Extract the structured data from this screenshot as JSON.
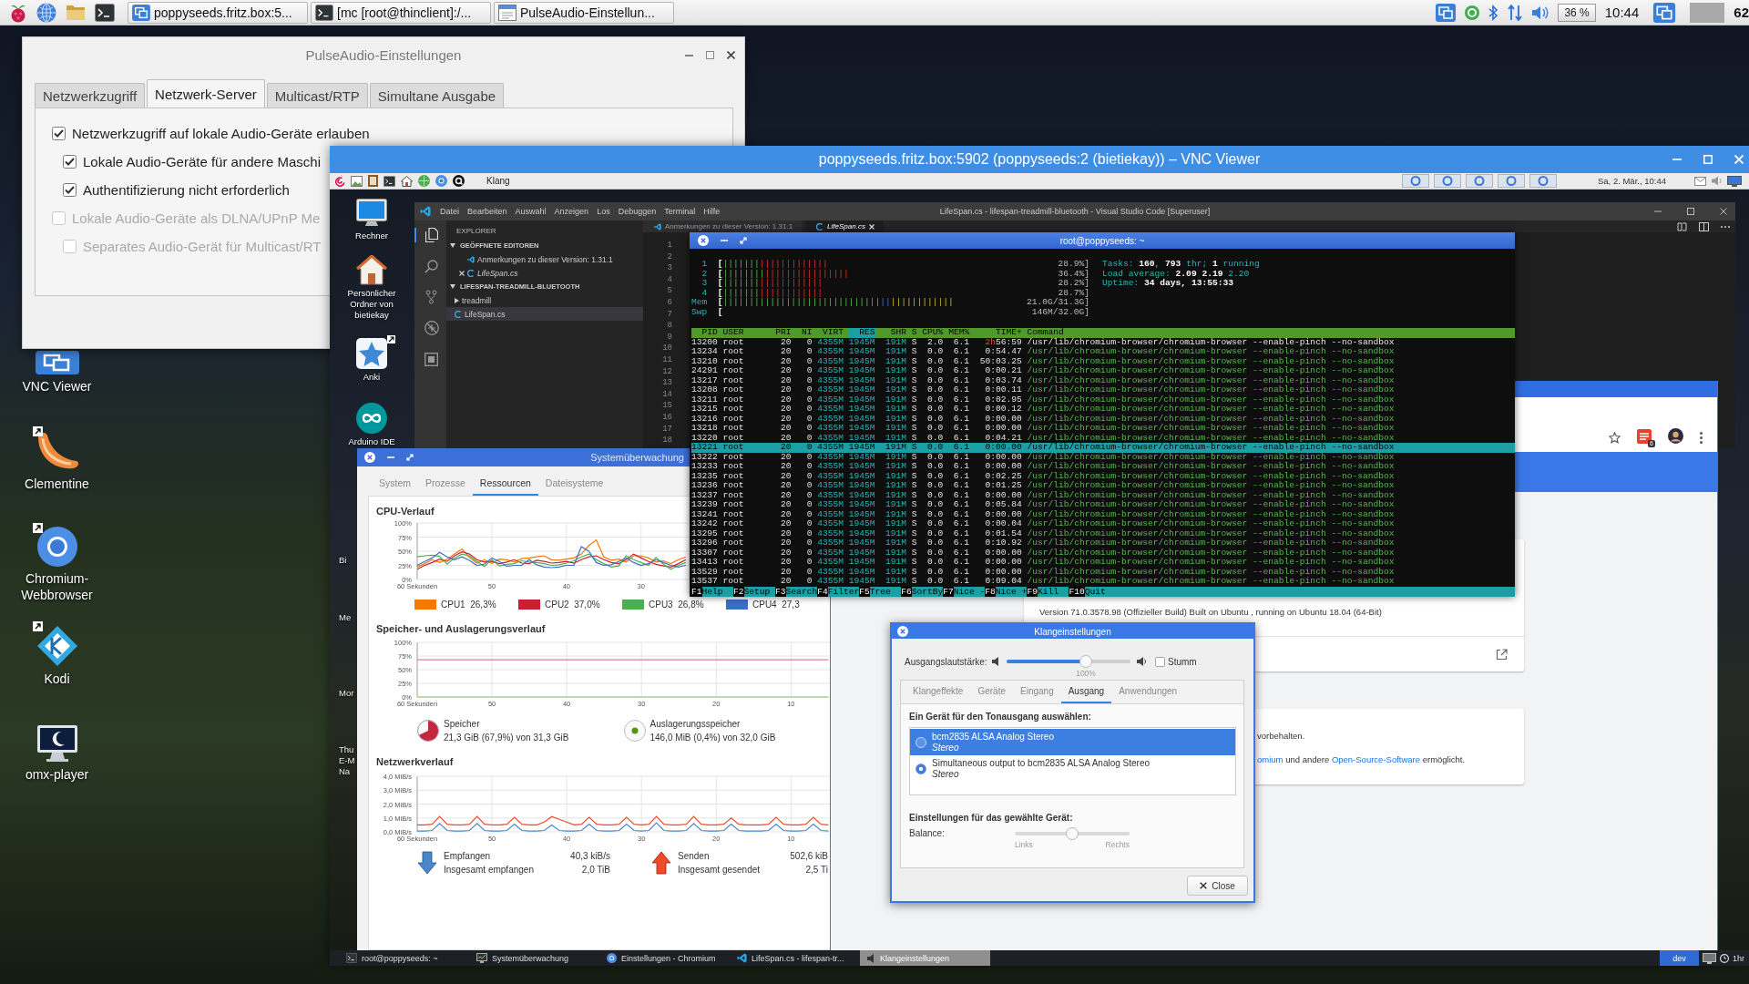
{
  "host_panel": {
    "tasks": [
      {
        "label": "poppyseeds.fritz.box:5...",
        "kind": "vnc",
        "selected": false
      },
      {
        "label": "[mc [root@thinclient]:/...",
        "kind": "terminal",
        "selected": false
      },
      {
        "label": "PulseAudio-Einstellun...",
        "kind": "settings",
        "selected": false
      }
    ],
    "cpu_usage": "36 %",
    "clock": "10:44",
    "counter": "62"
  },
  "desktop_icons": [
    {
      "label": "VNC Viewer",
      "kind": "vnc",
      "shortcut": false
    },
    {
      "label": "Clementine",
      "kind": "clementine",
      "shortcut": true
    },
    {
      "label": "Chromium-Webbrowser",
      "kind": "chromium",
      "shortcut": true
    },
    {
      "label": "Kodi",
      "kind": "kodi",
      "shortcut": true
    },
    {
      "label": "omx-player",
      "kind": "monitor",
      "shortcut": false
    }
  ],
  "pulseaudio_window": {
    "title": "PulseAudio-Einstellungen",
    "tabs": [
      {
        "label": "Netzwerkzugriff",
        "selected": false
      },
      {
        "label": "Netzwerk-Server",
        "selected": true
      },
      {
        "label": "Multicast/RTP",
        "selected": false
      },
      {
        "label": "Simultane Ausgabe",
        "selected": false
      }
    ],
    "options": [
      {
        "label": "Netzwerkzugriff auf lokale Audio-Geräte erlauben",
        "checked": true,
        "disabled": false,
        "children": [
          {
            "label": "Lokale Audio-Geräte für andere Maschi",
            "checked": true,
            "disabled": false
          },
          {
            "label": "Authentifizierung nicht erforderlich",
            "checked": true,
            "disabled": false
          }
        ]
      },
      {
        "label": "Lokale Audio-Geräte als DLNA/UPnP Me",
        "checked": false,
        "disabled": true,
        "children": [
          {
            "label": "Separates Audio-Gerät für Multicast/RT",
            "checked": false,
            "disabled": true
          }
        ]
      }
    ]
  },
  "vnc_window": {
    "title": "poppyseeds.fritz.box:5902 (poppyseeds:2 (bietiekay)) – VNC Viewer",
    "remote_panel": {
      "launcher_label": "Klang",
      "clock": "Sa, 2. Mär., 10:44"
    },
    "remote_desktop_icons": [
      {
        "label": "Rechner",
        "kind": "monitor",
        "shortcut": false
      },
      {
        "label": "Persönlicher Ordner von bietiekay",
        "kind": "home",
        "shortcut": false
      },
      {
        "label": "Anki",
        "kind": "star-card",
        "shortcut": true
      },
      {
        "label": "Arduino IDE",
        "kind": "infinity",
        "shortcut": false
      }
    ],
    "partial_icon_labels": [
      "Bi",
      "Me",
      "Mor",
      "Thu",
      "E-M",
      "Na"
    ],
    "code_editor": {
      "title": "LifeSpan.cs - lifespan-treadmill-bluetooth - Visual Studio Code [Superuser]",
      "menu": [
        "Datei",
        "Bearbeiten",
        "Auswahl",
        "Anzeigen",
        "Los",
        "Debuggen",
        "Terminal",
        "Hilfe"
      ],
      "activity_bar": [
        {
          "kind": "files",
          "selected": true
        },
        {
          "kind": "search",
          "selected": false
        },
        {
          "kind": "source-control",
          "selected": false
        },
        {
          "kind": "debug",
          "selected": false
        },
        {
          "kind": "extensions",
          "selected": false
        }
      ],
      "explorer": {
        "heading": "EXPLORER",
        "sections": [
          {
            "title": "GEÖFFNETE EDITOREN",
            "expanded": true,
            "items": [
              {
                "label": "Anmerkungen zu dieser Version: 1.31.1",
                "kind": "release-notes",
                "selected": false,
                "preview": false
              },
              {
                "label": "LifeSpan.cs",
                "kind": "csharp",
                "selected": true,
                "preview": true
              }
            ]
          },
          {
            "title": "LIFESPAN-TREADMILL-BLUETOOTH",
            "expanded": true,
            "items": [
              {
                "label": "treadmill",
                "kind": "folder",
                "expanded": false,
                "selected": false,
                "preview": false
              },
              {
                "label": "LifeSpan.cs",
                "kind": "csharp",
                "selected": true,
                "preview": false
              }
            ]
          }
        ]
      },
      "tabs": [
        {
          "label": "Anmerkungen zu dieser Version: 1.31.1",
          "kind": "release-notes",
          "selected": false,
          "preview": false
        },
        {
          "label": "LifeSpan.cs",
          "kind": "csharp",
          "selected": true,
          "preview": true
        }
      ],
      "line_numbers": [
        "1",
        "2",
        "3",
        "4",
        "5",
        "6",
        "7",
        "8",
        "9",
        "10",
        "11",
        "12",
        "13",
        "14",
        "15",
        "16",
        "17",
        "18"
      ]
    },
    "terminal": {
      "title": "root@poppyseeds: ~",
      "meters": [
        {
          "label": "1",
          "bracket": "[",
          "bars": [
            {
              "text": "|||||||",
              "kind": "normal"
            },
            {
              "text": "|||||||||||||",
              "kind": "kernel"
            }
          ],
          "reading": "28.9%]"
        },
        {
          "label": "2",
          "bracket": "[",
          "bars": [
            {
              "text": "||||||||",
              "kind": "normal"
            },
            {
              "text": "||||||||||||||||",
              "kind": "kernel"
            }
          ],
          "reading": "36.4%]"
        },
        {
          "label": "3",
          "bracket": "[",
          "bars": [
            {
              "text": "|||||||",
              "kind": "normal"
            },
            {
              "text": "||||||||||||",
              "kind": "kernel"
            }
          ],
          "reading": "28.2%]"
        },
        {
          "label": "4",
          "bracket": "[",
          "bars": [
            {
              "text": "|||||||",
              "kind": "normal"
            },
            {
              "text": "||||||||||||",
              "kind": "kernel"
            }
          ],
          "reading": "28.7%]"
        },
        {
          "label": "Mem",
          "bracket": "[",
          "bars": [
            {
              "text": "||||||||||||||||||||||||||||||",
              "kind": "used"
            },
            {
              "text": "||",
              "kind": "buffers"
            },
            {
              "text": "||||||||||||",
              "kind": "cache"
            }
          ],
          "reading": "21.0G/31.3G]"
        },
        {
          "label": "Swp",
          "bracket": "[",
          "reading": "146M/32.0G]"
        }
      ],
      "summary": [
        "Tasks: **160**, **793** thr; **1** running",
        "Load average: **2.09** **2.19** 2.20",
        "Uptime: **34 days, 13:55:33**"
      ],
      "columns": [
        {
          "label": "PID",
          "selected": false
        },
        {
          "label": "USER",
          "selected": false
        },
        {
          "label": "PRI",
          "selected": false
        },
        {
          "label": "NI",
          "selected": false
        },
        {
          "label": "VIRT",
          "selected": false
        },
        {
          "label": "RES",
          "selected": true
        },
        {
          "label": "SHR",
          "selected": false
        },
        {
          "label": "S",
          "selected": false
        },
        {
          "label": "CPU%",
          "selected": false
        },
        {
          "label": "MEM%",
          "selected": false
        },
        {
          "label": "TIME+",
          "selected": false
        },
        {
          "label": "Command",
          "selected": false
        }
      ],
      "rows": [
        {
          "cells": [
            "13200",
            "root",
            "20",
            "0",
            "4355M",
            "1945M",
            "191M",
            "S",
            "2.0",
            "6.1",
            "**2h**56:59",
            "/usr/lib/chromium-browser/chromium-browser --enable-pinch --no-sandbox"
          ],
          "selected": false,
          "thread": false
        },
        {
          "cells": [
            "13234",
            "root",
            "20",
            "0",
            "4355M",
            "1945M",
            "191M",
            "S",
            "0.0",
            "6.1",
            "0:54.47",
            "/usr/lib/chromium-browser/chromium-browser --enable-pinch --no-sandbox"
          ],
          "selected": false,
          "thread": true
        },
        {
          "cells": [
            "13210",
            "root",
            "20",
            "0",
            "4355M",
            "1945M",
            "191M",
            "S",
            "0.0",
            "6.1",
            "50:03.25",
            "/usr/lib/chromium-browser/chromium-browser --enable-pinch --no-sandbox"
          ],
          "selected": false,
          "thread": true
        },
        {
          "cells": [
            "24291",
            "root",
            "20",
            "0",
            "4355M",
            "1945M",
            "191M",
            "S",
            "0.0",
            "6.1",
            "0:00.21",
            "/usr/lib/chromium-browser/chromium-browser --enable-pinch --no-sandbox"
          ],
          "selected": false,
          "thread": true
        },
        {
          "cells": [
            "13217",
            "root",
            "20",
            "0",
            "4355M",
            "1945M",
            "191M",
            "S",
            "0.0",
            "6.1",
            "0:03.74",
            "/usr/lib/chromium-browser/chromium-browser --enable-pinch --no-sandbox"
          ],
          "selected": false,
          "thread": true
        },
        {
          "cells": [
            "13208",
            "root",
            "20",
            "0",
            "4355M",
            "1945M",
            "191M",
            "S",
            "0.0",
            "6.1",
            "0:00.11",
            "/usr/lib/chromium-browser/chromium-browser --enable-pinch --no-sandbox"
          ],
          "selected": false,
          "thread": true
        },
        {
          "cells": [
            "13211",
            "root",
            "20",
            "0",
            "4355M",
            "1945M",
            "191M",
            "S",
            "0.0",
            "6.1",
            "0:02.95",
            "/usr/lib/chromium-browser/chromium-browser --enable-pinch --no-sandbox"
          ],
          "selected": false,
          "thread": true
        },
        {
          "cells": [
            "13215",
            "root",
            "20",
            "0",
            "4355M",
            "1945M",
            "191M",
            "S",
            "0.0",
            "6.1",
            "0:00.12",
            "/usr/lib/chromium-browser/chromium-browser --enable-pinch --no-sandbox"
          ],
          "selected": false,
          "thread": true
        },
        {
          "cells": [
            "13216",
            "root",
            "20",
            "0",
            "4355M",
            "1945M",
            "191M",
            "S",
            "0.0",
            "6.1",
            "0:00.00",
            "/usr/lib/chromium-browser/chromium-browser --enable-pinch --no-sandbox"
          ],
          "selected": false,
          "thread": true
        },
        {
          "cells": [
            "13218",
            "root",
            "20",
            "0",
            "4355M",
            "1945M",
            "191M",
            "S",
            "0.0",
            "6.1",
            "0:00.00",
            "/usr/lib/chromium-browser/chromium-browser --enable-pinch --no-sandbox"
          ],
          "selected": false,
          "thread": true
        },
        {
          "cells": [
            "13220",
            "root",
            "20",
            "0",
            "4355M",
            "1945M",
            "191M",
            "S",
            "0.0",
            "6.1",
            "0:04.21",
            "/usr/lib/chromium-browser/chromium-browser --enable-pinch --no-sandbox"
          ],
          "selected": false,
          "thread": true
        },
        {
          "cells": [
            "13221",
            "root",
            "20",
            "0",
            "4355M",
            "1945M",
            "191M",
            "S",
            "0.0",
            "6.1",
            "0:00.00",
            "/usr/lib/chromium-browser/chromium-browser --enable-pinch --no-sandbox"
          ],
          "selected": true,
          "thread": true
        },
        {
          "cells": [
            "13222",
            "root",
            "20",
            "0",
            "4355M",
            "1945M",
            "191M",
            "S",
            "0.0",
            "6.1",
            "0:00.00",
            "/usr/lib/chromium-browser/chromium-browser --enable-pinch --no-sandbox"
          ],
          "selected": false,
          "thread": true
        },
        {
          "cells": [
            "13233",
            "root",
            "20",
            "0",
            "4355M",
            "1945M",
            "191M",
            "S",
            "0.0",
            "6.1",
            "0:00.00",
            "/usr/lib/chromium-browser/chromium-browser --enable-pinch --no-sandbox"
          ],
          "selected": false,
          "thread": true
        },
        {
          "cells": [
            "13235",
            "root",
            "20",
            "0",
            "4355M",
            "1945M",
            "191M",
            "S",
            "0.0",
            "6.1",
            "0:02.25",
            "/usr/lib/chromium-browser/chromium-browser --enable-pinch --no-sandbox"
          ],
          "selected": false,
          "thread": true
        },
        {
          "cells": [
            "13236",
            "root",
            "20",
            "0",
            "4355M",
            "1945M",
            "191M",
            "S",
            "0.0",
            "6.1",
            "0:01.25",
            "/usr/lib/chromium-browser/chromium-browser --enable-pinch --no-sandbox"
          ],
          "selected": false,
          "thread": true
        },
        {
          "cells": [
            "13237",
            "root",
            "20",
            "0",
            "4355M",
            "1945M",
            "191M",
            "S",
            "0.0",
            "6.1",
            "0:00.00",
            "/usr/lib/chromium-browser/chromium-browser --enable-pinch --no-sandbox"
          ],
          "selected": false,
          "thread": true
        },
        {
          "cells": [
            "13239",
            "root",
            "20",
            "0",
            "4355M",
            "1945M",
            "191M",
            "S",
            "0.0",
            "6.1",
            "0:05.84",
            "/usr/lib/chromium-browser/chromium-browser --enable-pinch --no-sandbox"
          ],
          "selected": false,
          "thread": true
        },
        {
          "cells": [
            "13241",
            "root",
            "20",
            "0",
            "4355M",
            "1945M",
            "191M",
            "S",
            "0.0",
            "6.1",
            "0:00.00",
            "/usr/lib/chromium-browser/chromium-browser --enable-pinch --no-sandbox"
          ],
          "selected": false,
          "thread": true
        },
        {
          "cells": [
            "13242",
            "root",
            "20",
            "0",
            "4355M",
            "1945M",
            "191M",
            "S",
            "0.0",
            "6.1",
            "0:00.04",
            "/usr/lib/chromium-browser/chromium-browser --enable-pinch --no-sandbox"
          ],
          "selected": false,
          "thread": true
        },
        {
          "cells": [
            "13295",
            "root",
            "20",
            "0",
            "4355M",
            "1945M",
            "191M",
            "S",
            "0.0",
            "6.1",
            "0:01.54",
            "/usr/lib/chromium-browser/chromium-browser --enable-pinch --no-sandbox"
          ],
          "selected": false,
          "thread": true
        },
        {
          "cells": [
            "13296",
            "root",
            "20",
            "0",
            "4355M",
            "1945M",
            "191M",
            "S",
            "0.0",
            "6.1",
            "0:10.92",
            "/usr/lib/chromium-browser/chromium-browser --enable-pinch --no-sandbox"
          ],
          "selected": false,
          "thread": true
        },
        {
          "cells": [
            "13307",
            "root",
            "20",
            "0",
            "4355M",
            "1945M",
            "191M",
            "S",
            "0.0",
            "6.1",
            "0:00.00",
            "/usr/lib/chromium-browser/chromium-browser --enable-pinch --no-sandbox"
          ],
          "selected": false,
          "thread": true
        },
        {
          "cells": [
            "13413",
            "root",
            "20",
            "0",
            "4355M",
            "1945M",
            "191M",
            "S",
            "0.0",
            "6.1",
            "0:00.00",
            "/usr/lib/chromium-browser/chromium-browser --enable-pinch --no-sandbox"
          ],
          "selected": false,
          "thread": true
        },
        {
          "cells": [
            "13529",
            "root",
            "20",
            "0",
            "4355M",
            "1945M",
            "191M",
            "S",
            "0.0",
            "6.1",
            "0:00.00",
            "/usr/lib/chromium-browser/chromium-browser --enable-pinch --no-sandbox"
          ],
          "selected": false,
          "thread": true
        },
        {
          "cells": [
            "13537",
            "root",
            "20",
            "0",
            "4355M",
            "1945M",
            "191M",
            "S",
            "0.0",
            "6.1",
            "0:09.04",
            "/usr/lib/chromium-browser/chromium-browser --enable-pinch --no-sandbox"
          ],
          "selected": false,
          "thread": true
        }
      ],
      "function_keys": [
        {
          "key": "F1",
          "label": "Help"
        },
        {
          "key": "F2",
          "label": "Setup"
        },
        {
          "key": "F3",
          "label": "Search"
        },
        {
          "key": "F4",
          "label": "Filter"
        },
        {
          "key": "F5",
          "label": "Tree"
        },
        {
          "key": "F6",
          "label": "SortBy"
        },
        {
          "key": "F7",
          "label": "Nice -"
        },
        {
          "key": "F8",
          "label": "Nice +"
        },
        {
          "key": "F9",
          "label": "Kill"
        },
        {
          "key": "F10",
          "label": "Quit"
        }
      ]
    },
    "system_monitor": {
      "title": "Systemüberwachung",
      "tabs": [
        {
          "label": "System",
          "selected": false
        },
        {
          "label": "Prozesse",
          "selected": false
        },
        {
          "label": "Ressourcen",
          "selected": true
        },
        {
          "label": "Dateisysteme",
          "selected": false
        }
      ],
      "cpu": {
        "heading": "CPU-Verlauf",
        "chart_data": {
          "type": "line",
          "x": [
            60,
            59,
            58,
            57,
            56,
            55,
            54,
            53,
            52,
            51,
            50,
            49,
            48,
            47,
            46,
            45,
            44,
            43,
            42,
            41,
            40,
            39,
            38,
            37,
            36,
            35,
            34,
            33,
            32,
            31,
            30,
            29,
            28,
            27,
            26,
            25,
            24
          ],
          "series": [
            {
              "name": "CPU1",
              "color": "#f57900",
              "values": [
                22,
                28,
                35,
                30,
                36,
                45,
                54,
                39,
                29,
                35,
                28,
                36,
                35,
                31,
                37,
                38,
                40,
                42,
                35,
                34,
                36,
                38,
                45,
                60,
                70,
                40,
                34,
                36,
                31,
                42,
                42,
                38,
                31,
                33,
                28,
                35,
                40
              ]
            },
            {
              "name": "CPU2",
              "color": "#cc1f2f",
              "values": [
                18,
                25,
                30,
                36,
                32,
                42,
                49,
                45,
                35,
                31,
                32,
                28,
                31,
                35,
                29,
                28,
                34,
                32,
                29,
                30,
                32,
                29,
                35,
                40,
                42,
                35,
                30,
                28,
                35,
                45,
                38,
                32,
                27,
                24,
                22,
                28,
                35
              ]
            },
            {
              "name": "CPU3",
              "color": "#4caf50",
              "values": [
                40,
                42,
                43,
                41,
                27,
                38,
                45,
                42,
                32,
                23,
                35,
                24,
                27,
                28,
                33,
                31,
                30,
                28,
                25,
                26,
                29,
                33,
                40,
                45,
                35,
                28,
                22,
                24,
                42,
                35,
                30,
                25,
                39,
                27,
                18,
                25,
                30
              ]
            },
            {
              "name": "CPU4",
              "color": "#3a6fc4",
              "values": [
                25,
                32,
                38,
                48,
                40,
                35,
                40,
                34,
                25,
                27,
                38,
                32,
                23,
                25,
                25,
                35,
                26,
                22,
                21,
                22,
                25,
                25,
                58,
                50,
                30,
                25,
                26,
                32,
                38,
                30,
                25,
                28,
                35,
                30,
                25,
                22,
                25
              ]
            }
          ],
          "xlim": [
            60,
            23.5
          ],
          "ylim": [
            0,
            100
          ],
          "grid": true,
          "xticks": [
            {
              "value": 60,
              "label": "60 Sekunden"
            },
            {
              "value": 50,
              "label": "50"
            },
            {
              "value": 40,
              "label": "40"
            },
            {
              "value": 30,
              "label": "30"
            }
          ],
          "yticks": [
            {
              "value": 100,
              "label": "100%"
            },
            {
              "value": 75,
              "label": "75%"
            },
            {
              "value": 50,
              "label": "50%"
            },
            {
              "value": 25,
              "label": "25%"
            },
            {
              "value": 0,
              "label": "0%"
            }
          ]
        },
        "legend_values": [
          "26,3%",
          "37,0%",
          "26,8%",
          "27,3"
        ]
      },
      "memory": {
        "heading": "Speicher- und Auslagerungsverlauf",
        "chart_data": {
          "type": "line",
          "x": [
            60,
            5
          ],
          "series": [
            {
              "name": "Speicher",
              "color": "#e27d92",
              "values": [
                68,
                68
              ]
            },
            {
              "name": "Auslagerungsspeicher",
              "color": "#8cc46c",
              "values": [
                0,
                0
              ]
            }
          ],
          "xlim": [
            60,
            4.8
          ],
          "ylim": [
            0,
            100
          ],
          "grid": true,
          "xticks": [
            {
              "value": 60,
              "label": "60 Sekunden"
            },
            {
              "value": 50,
              "label": "50"
            },
            {
              "value": 40,
              "label": "40"
            },
            {
              "value": 30,
              "label": "30"
            },
            {
              "value": 20,
              "label": "20"
            },
            {
              "value": 10,
              "label": "10"
            }
          ],
          "yticks": [
            {
              "value": 100,
              "label": "100%"
            },
            {
              "value": 75,
              "label": "75%"
            },
            {
              "value": 50,
              "label": "50%"
            },
            {
              "value": 25,
              "label": "25%"
            },
            {
              "value": 0,
              "label": "0%"
            }
          ]
        },
        "ram_value": "21,3 GiB (67,9%) von 31,3 GiB",
        "swap_value": "146,0 MiB (0,4%) von 32,0 GiB"
      },
      "network": {
        "heading": "Netzwerkverlauf",
        "chart_data": {
          "type": "line",
          "x": [
            60,
            59,
            58,
            57,
            56,
            55,
            54,
            53,
            52,
            51,
            50,
            49,
            48,
            47,
            46,
            45,
            44,
            43,
            42,
            41,
            40,
            39,
            38,
            37,
            36,
            35,
            34,
            33,
            32,
            31,
            30,
            29,
            28,
            27,
            26,
            25,
            24,
            23,
            22,
            21,
            20,
            19,
            18,
            17,
            16,
            15,
            14,
            13,
            12,
            11,
            10,
            9,
            8,
            7,
            6,
            5
          ],
          "series": [
            {
              "name": "Empfangen",
              "color": "#4a86c8",
              "values": [
                0.05,
                0.05,
                0.1,
                0.6,
                0.1,
                0.05,
                0.05,
                0.1,
                0.6,
                0.1,
                0.05,
                0.05,
                0.1,
                0.55,
                0.1,
                0.05,
                0.05,
                0.1,
                0.5,
                0.1,
                0.05,
                0.05,
                0.1,
                0.55,
                0.1,
                0.05,
                0.05,
                0.1,
                0.55,
                0.1,
                0.05,
                0.1,
                0.65,
                0.1,
                0.05,
                0.05,
                0.1,
                0.6,
                0.1,
                0.05,
                0.05,
                0.1,
                0.55,
                0.1,
                0.05,
                0.05,
                0.05,
                0.1,
                0.55,
                0.1,
                0.05,
                0.05,
                0.1,
                0.55,
                0.1,
                0.05
              ]
            },
            {
              "name": "Senden",
              "color": "#ef4a2a",
              "values": [
                0.5,
                0.5,
                0.55,
                1.1,
                0.55,
                0.5,
                0.5,
                0.55,
                1.1,
                0.55,
                0.5,
                0.5,
                0.55,
                1.05,
                0.55,
                0.5,
                0.5,
                0.7,
                1.1,
                0.9,
                0.7,
                0.5,
                0.55,
                1.05,
                0.55,
                0.5,
                0.5,
                0.55,
                1.05,
                0.55,
                0.5,
                0.55,
                1.1,
                0.55,
                0.5,
                0.5,
                0.55,
                1.1,
                0.55,
                0.5,
                0.5,
                0.55,
                1.0,
                0.55,
                0.5,
                0.5,
                0.5,
                0.55,
                1.05,
                0.55,
                0.5,
                0.5,
                0.55,
                1.05,
                0.55,
                0.5
              ]
            }
          ],
          "xlim": [
            60,
            4.8
          ],
          "ylim": [
            0,
            4
          ],
          "grid": true,
          "xticks": [
            {
              "value": 60,
              "label": "60 Sekunden"
            },
            {
              "value": 50,
              "label": "50"
            },
            {
              "value": 40,
              "label": "40"
            },
            {
              "value": 30,
              "label": "30"
            },
            {
              "value": 20,
              "label": "20"
            },
            {
              "value": 10,
              "label": "10"
            }
          ],
          "yticks": [
            {
              "value": 4,
              "label": "4,0 MiB/s"
            },
            {
              "value": 3,
              "label": "3,0 MiB/s"
            },
            {
              "value": 2,
              "label": "2,0 MiB/s"
            },
            {
              "value": 1,
              "label": "1,0 MiB/s"
            },
            {
              "value": 0,
              "label": "0,0 MiB/s"
            }
          ]
        },
        "receive": {
          "rate": "40,3 kiB/s",
          "total_label": "Insgesamt empfangen",
          "total": "2,0 TiB"
        },
        "send": {
          "rate": "502,6 kiB",
          "total_label": "Insgesamt gesendet",
          "total": "2,5 Ti"
        }
      }
    },
    "browser": {
      "extension_badge": "6",
      "version": "Version 71.0.3578.98 (Offizieller Build) Built on Ubuntu , running on Ubuntu 18.04 (64-Bit)",
      "rights": "vorbehalten.",
      "credits": [
        {
          "text": "omium",
          "link": true
        },
        {
          "text": " und andere ",
          "link": false
        },
        {
          "text": "Open-Source-Software",
          "link": true
        },
        {
          "text": " ermöglicht.",
          "link": false
        }
      ]
    },
    "sound_dialog": {
      "title": "Klangeinstellungen",
      "volume": {
        "label": "Ausgangslautstärke:",
        "level": 0.64,
        "reading": "100%"
      },
      "mute": {
        "label": "Stumm",
        "checked": false
      },
      "tabs": [
        {
          "label": "Klangeffekte",
          "selected": false
        },
        {
          "label": "Geräte",
          "selected": false
        },
        {
          "label": "Eingang",
          "selected": false
        },
        {
          "label": "Ausgang",
          "selected": true
        },
        {
          "label": "Anwendungen",
          "selected": false
        }
      ],
      "device_heading": "Ein Gerät für den Tonausgang auswählen:",
      "devices": [
        {
          "name": "bcm2835 ALSA Analog Stereo",
          "profile": "Stereo",
          "selected": true,
          "checked": false
        },
        {
          "name": "Simultaneous output to bcm2835 ALSA Analog Stereo",
          "profile": "Stereo",
          "selected": false,
          "checked": true
        }
      ],
      "settings_heading": "Einstellungen für das gewählte Gerät:",
      "balance": {
        "label": "Balance:",
        "level": 0.5,
        "left": "Links",
        "right": "Rechts"
      },
      "close_button": "Close"
    },
    "remote_taskbar": {
      "tasks": [
        {
          "label": "root@poppyseeds: ~",
          "kind": "terminal",
          "selected": false
        },
        {
          "label": "Systemüberwachung",
          "kind": "monitor",
          "selected": false
        },
        {
          "label": "Einstellungen - Chromium",
          "kind": "browser",
          "selected": false
        },
        {
          "label": "LifeSpan.cs - lifespan-tr...",
          "kind": "editor",
          "selected": false
        },
        {
          "label": "Klangeinstellungen",
          "kind": "speaker",
          "selected": true
        }
      ],
      "workspace": "dev",
      "indicator": "1hr"
    }
  }
}
